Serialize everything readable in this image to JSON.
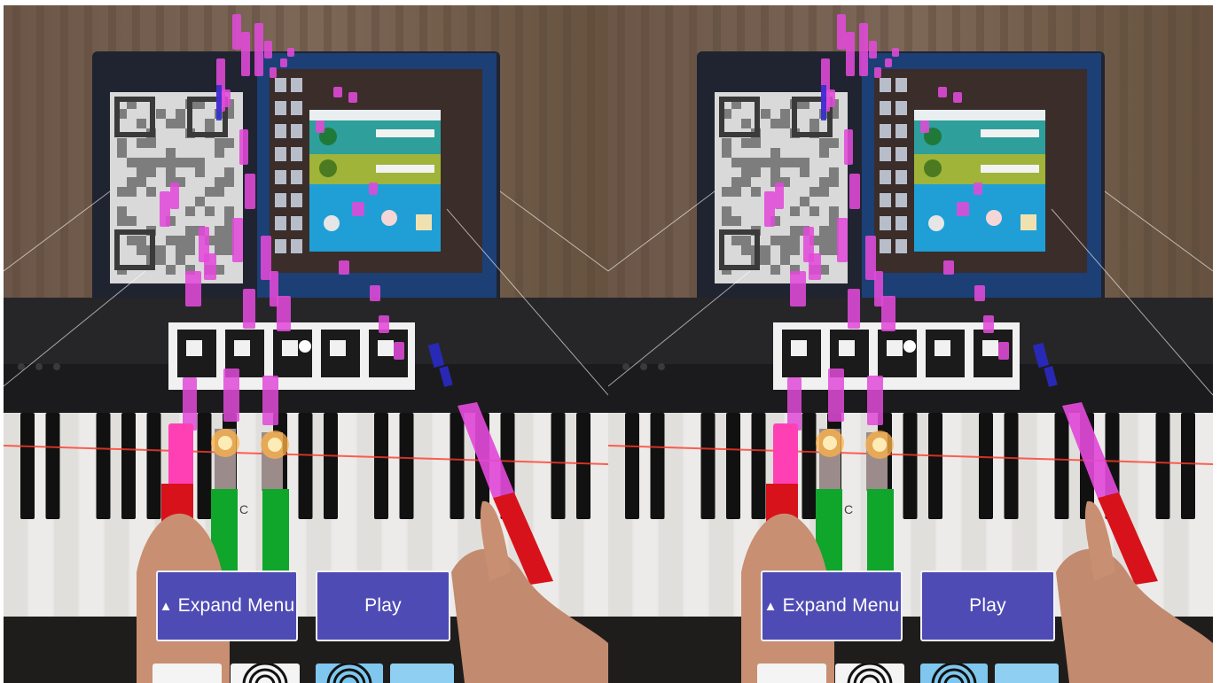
{
  "app": {
    "view_mode": "stereo",
    "eyes": [
      "left",
      "right"
    ]
  },
  "controls": {
    "expand_menu_arrow": "▲",
    "expand_menu_label": "Expand Menu",
    "play_label": "Play"
  },
  "thumbnails": [
    {
      "name": "thumbnail-blank",
      "icon": "none"
    },
    {
      "name": "thumbnail-target",
      "icon": "target-icon"
    },
    {
      "name": "thumbnail-eye",
      "icon": "eye-icon"
    },
    {
      "name": "thumbnail-sky",
      "icon": "none"
    }
  ],
  "key_label": "C",
  "colors": {
    "button_bg": "#4f4bb4",
    "note_magenta": "#e14ad8",
    "note_blue": "#2a2ad0",
    "bar_red": "#d8121a",
    "bar_green": "#10a52b",
    "hit_line": "#ff3b2a"
  }
}
